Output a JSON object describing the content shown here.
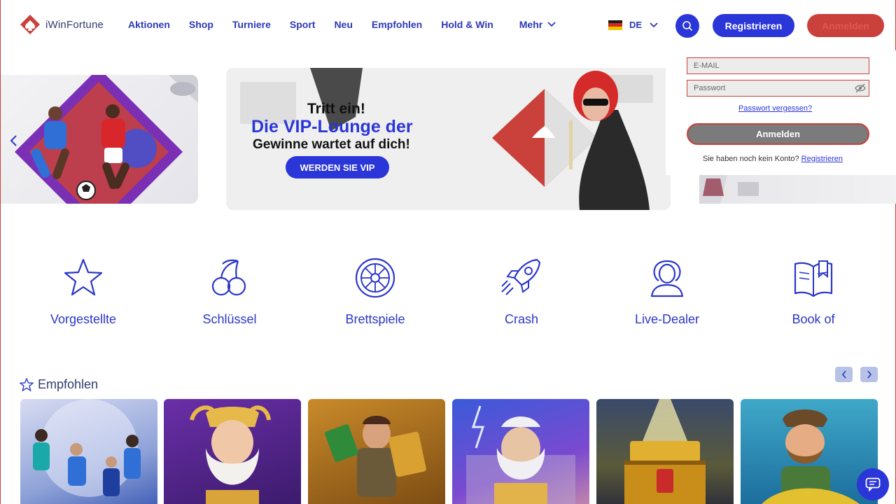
{
  "brand": {
    "name": "iWinFortune",
    "accent": "#2b36d9",
    "secondary": "#c9413a"
  },
  "nav": [
    {
      "label": "Aktionen"
    },
    {
      "label": "Shop"
    },
    {
      "label": "Turniere"
    },
    {
      "label": "Sport"
    },
    {
      "label": "Neu"
    },
    {
      "label": "Empfohlen"
    },
    {
      "label": "Hold & Win"
    }
  ],
  "nav_more": {
    "label": "Mehr",
    "icon": "chevron-down-icon"
  },
  "language": {
    "code": "DE",
    "flag": "germany-flag-icon"
  },
  "header_buttons": {
    "register": "Registrieren",
    "login": "Anmelden"
  },
  "banner": {
    "line1": "Tritt ein!",
    "line2": "Die VIP-Lounge der",
    "line3": "Gewinne wartet auf dich!",
    "cta": "WERDEN SIE VIP"
  },
  "login_form": {
    "email_placeholder": "E-MAIL",
    "password_placeholder": "Passwort",
    "forgot": "Passwort vergessen?",
    "submit": "Anmelden",
    "no_account": "Sie haben noch kein Konto?",
    "register_link": "Registrieren"
  },
  "categories": [
    {
      "label": "Vorgestellte",
      "icon": "star-icon"
    },
    {
      "label": "Schlüssel",
      "icon": "cherries-icon"
    },
    {
      "label": "Brettspiele",
      "icon": "roulette-icon"
    },
    {
      "label": "Crash",
      "icon": "rocket-icon"
    },
    {
      "label": "Live-Dealer",
      "icon": "dealer-icon"
    },
    {
      "label": "Book of",
      "icon": "book-icon"
    }
  ],
  "recommended": {
    "title": "Empfohlen"
  },
  "games": [
    {
      "theme": "football"
    },
    {
      "theme": "zeus-gold"
    },
    {
      "theme": "book-explorer"
    },
    {
      "theme": "zeus-storm"
    },
    {
      "theme": "treasure-chest"
    },
    {
      "theme": "fisherman"
    }
  ]
}
